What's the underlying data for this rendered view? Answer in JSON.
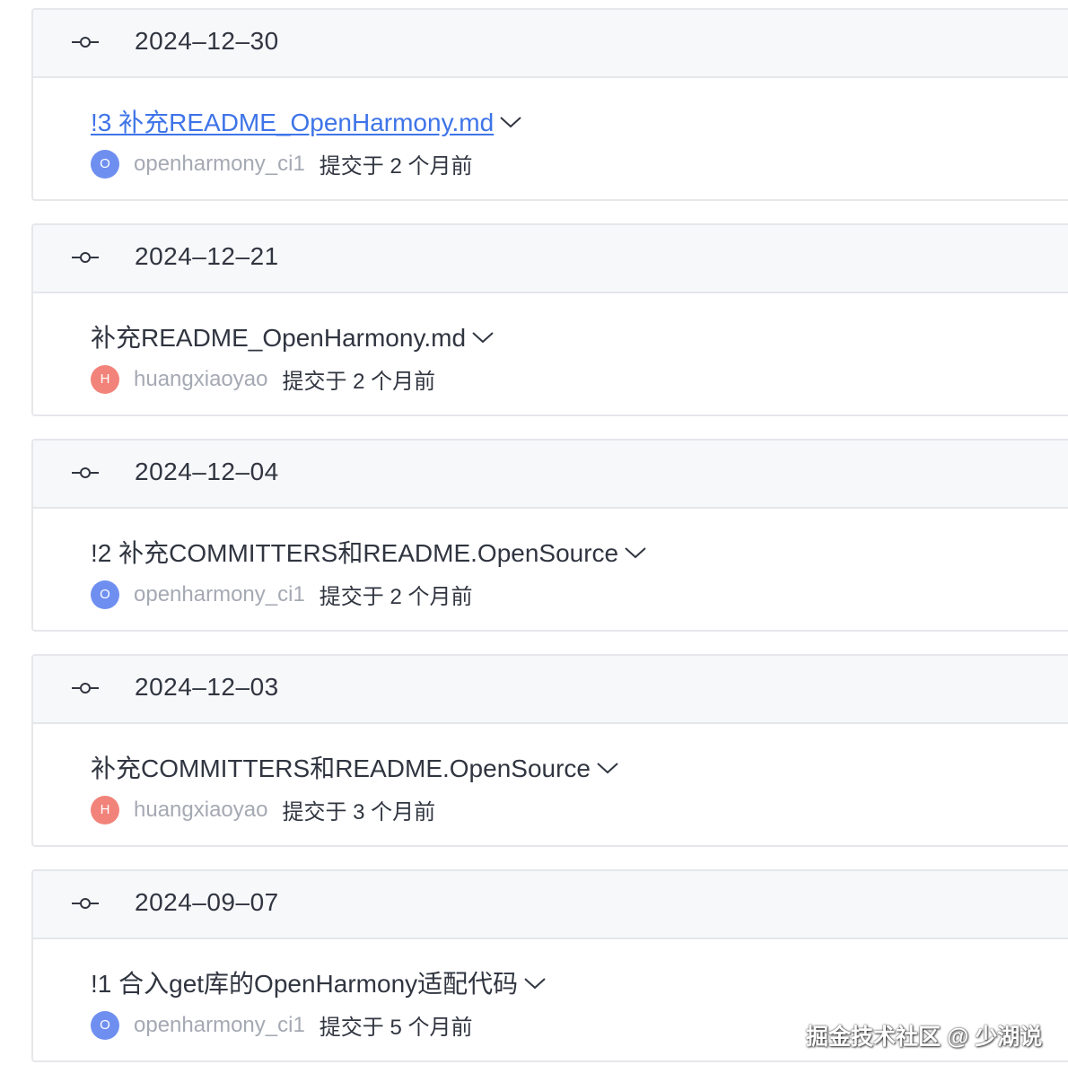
{
  "groups": [
    {
      "date": "2024–12–30",
      "title": "!3 补充README_OpenHarmony.md",
      "is_link": true,
      "avatar_letter": "O",
      "avatar_color": "#6f8ff0",
      "author": "openharmony_ci1",
      "time": "提交于 2 个月前"
    },
    {
      "date": "2024–12–21",
      "title": "补充README_OpenHarmony.md",
      "is_link": false,
      "avatar_letter": "H",
      "avatar_color": "#f2837a",
      "author": "huangxiaoyao",
      "time": "提交于 2 个月前"
    },
    {
      "date": "2024–12–04",
      "title": "!2 补充COMMITTERS和README.OpenSource",
      "is_link": false,
      "avatar_letter": "O",
      "avatar_color": "#6f8ff0",
      "author": "openharmony_ci1",
      "time": "提交于 2 个月前"
    },
    {
      "date": "2024–12–03",
      "title": "补充COMMITTERS和README.OpenSource",
      "is_link": false,
      "avatar_letter": "H",
      "avatar_color": "#f2837a",
      "author": "huangxiaoyao",
      "time": "提交于 3 个月前"
    },
    {
      "date": "2024–09–07",
      "title": "!1 合入get库的OpenHarmony适配代码",
      "is_link": false,
      "avatar_letter": "O",
      "avatar_color": "#6f8ff0",
      "author": "openharmony_ci1",
      "time": "提交于 5 个月前"
    }
  ],
  "icons": {
    "commit": "commit-node-icon",
    "expand": "chevron-down-icon"
  },
  "colors": {
    "link": "#3e74e8",
    "text": "#303540",
    "muted": "#a5a9b3"
  },
  "watermark": "掘金技术社区 @ 少湖说"
}
